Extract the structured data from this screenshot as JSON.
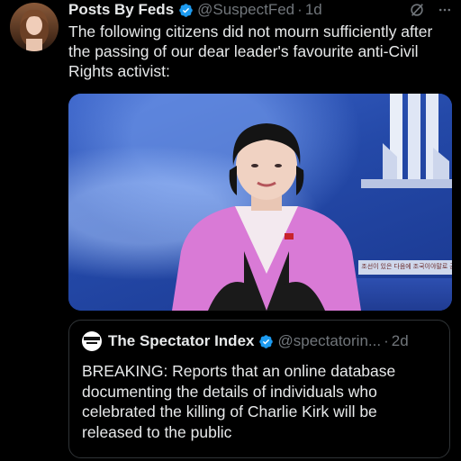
{
  "tweet": {
    "author_name": "Posts By Feds",
    "handle": "@SuspectFed",
    "separator": "·",
    "time": "1d",
    "text": "The following citizens did not mourn sufficiently after the passing of our dear leader's favourite anti-Civil Rights activist:",
    "more_icon": "more-icon",
    "grok_icon": "grok-icon"
  },
  "media": {
    "banner_text": "조선이 있은 다음에 조국이야말로 공화국인민이 만세"
  },
  "quote": {
    "author_name": "The Spectator Index",
    "handle": "@spectatorin...",
    "separator": "·",
    "time": "2d",
    "text": "BREAKING: Reports that an online database documenting the details of individuals who celebrated the killing of Charlie Kirk will be released to the public",
    "avatar_label": "SPECTATOR INDEX"
  },
  "colors": {
    "background": "#000000",
    "text": "#e7e9ea",
    "secondary": "#71767b",
    "verified": "#1d9bf0",
    "border": "#2f3336"
  }
}
